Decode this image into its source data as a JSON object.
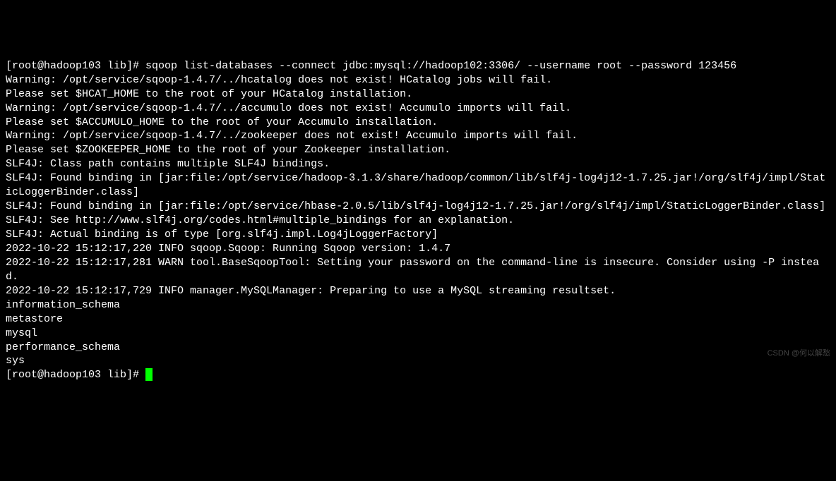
{
  "prompt1": {
    "prefix": "[root@hadoop103 lib]# ",
    "command": "sqoop list-databases --connect jdbc:mysql://hadoop102:3306/ --username root --password 123456"
  },
  "output_lines": [
    "Warning: /opt/service/sqoop-1.4.7/../hcatalog does not exist! HCatalog jobs will fail.",
    "Please set $HCAT_HOME to the root of your HCatalog installation.",
    "Warning: /opt/service/sqoop-1.4.7/../accumulo does not exist! Accumulo imports will fail.",
    "Please set $ACCUMULO_HOME to the root of your Accumulo installation.",
    "Warning: /opt/service/sqoop-1.4.7/../zookeeper does not exist! Accumulo imports will fail.",
    "Please set $ZOOKEEPER_HOME to the root of your Zookeeper installation.",
    "SLF4J: Class path contains multiple SLF4J bindings.",
    "SLF4J: Found binding in [jar:file:/opt/service/hadoop-3.1.3/share/hadoop/common/lib/slf4j-log4j12-1.7.25.jar!/org/slf4j/impl/StaticLoggerBinder.class]",
    "SLF4J: Found binding in [jar:file:/opt/service/hbase-2.0.5/lib/slf4j-log4j12-1.7.25.jar!/org/slf4j/impl/StaticLoggerBinder.class]",
    "SLF4J: See http://www.slf4j.org/codes.html#multiple_bindings for an explanation.",
    "SLF4J: Actual binding is of type [org.slf4j.impl.Log4jLoggerFactory]",
    "2022-10-22 15:12:17,220 INFO sqoop.Sqoop: Running Sqoop version: 1.4.7",
    "2022-10-22 15:12:17,281 WARN tool.BaseSqoopTool: Setting your password on the command-line is insecure. Consider using -P instead.",
    "2022-10-22 15:12:17,729 INFO manager.MySQLManager: Preparing to use a MySQL streaming resultset.",
    "information_schema",
    "metastore",
    "mysql",
    "performance_schema",
    "sys"
  ],
  "prompt2": {
    "prefix": "[root@hadoop103 lib]# "
  },
  "watermark": "CSDN @何以解愁"
}
